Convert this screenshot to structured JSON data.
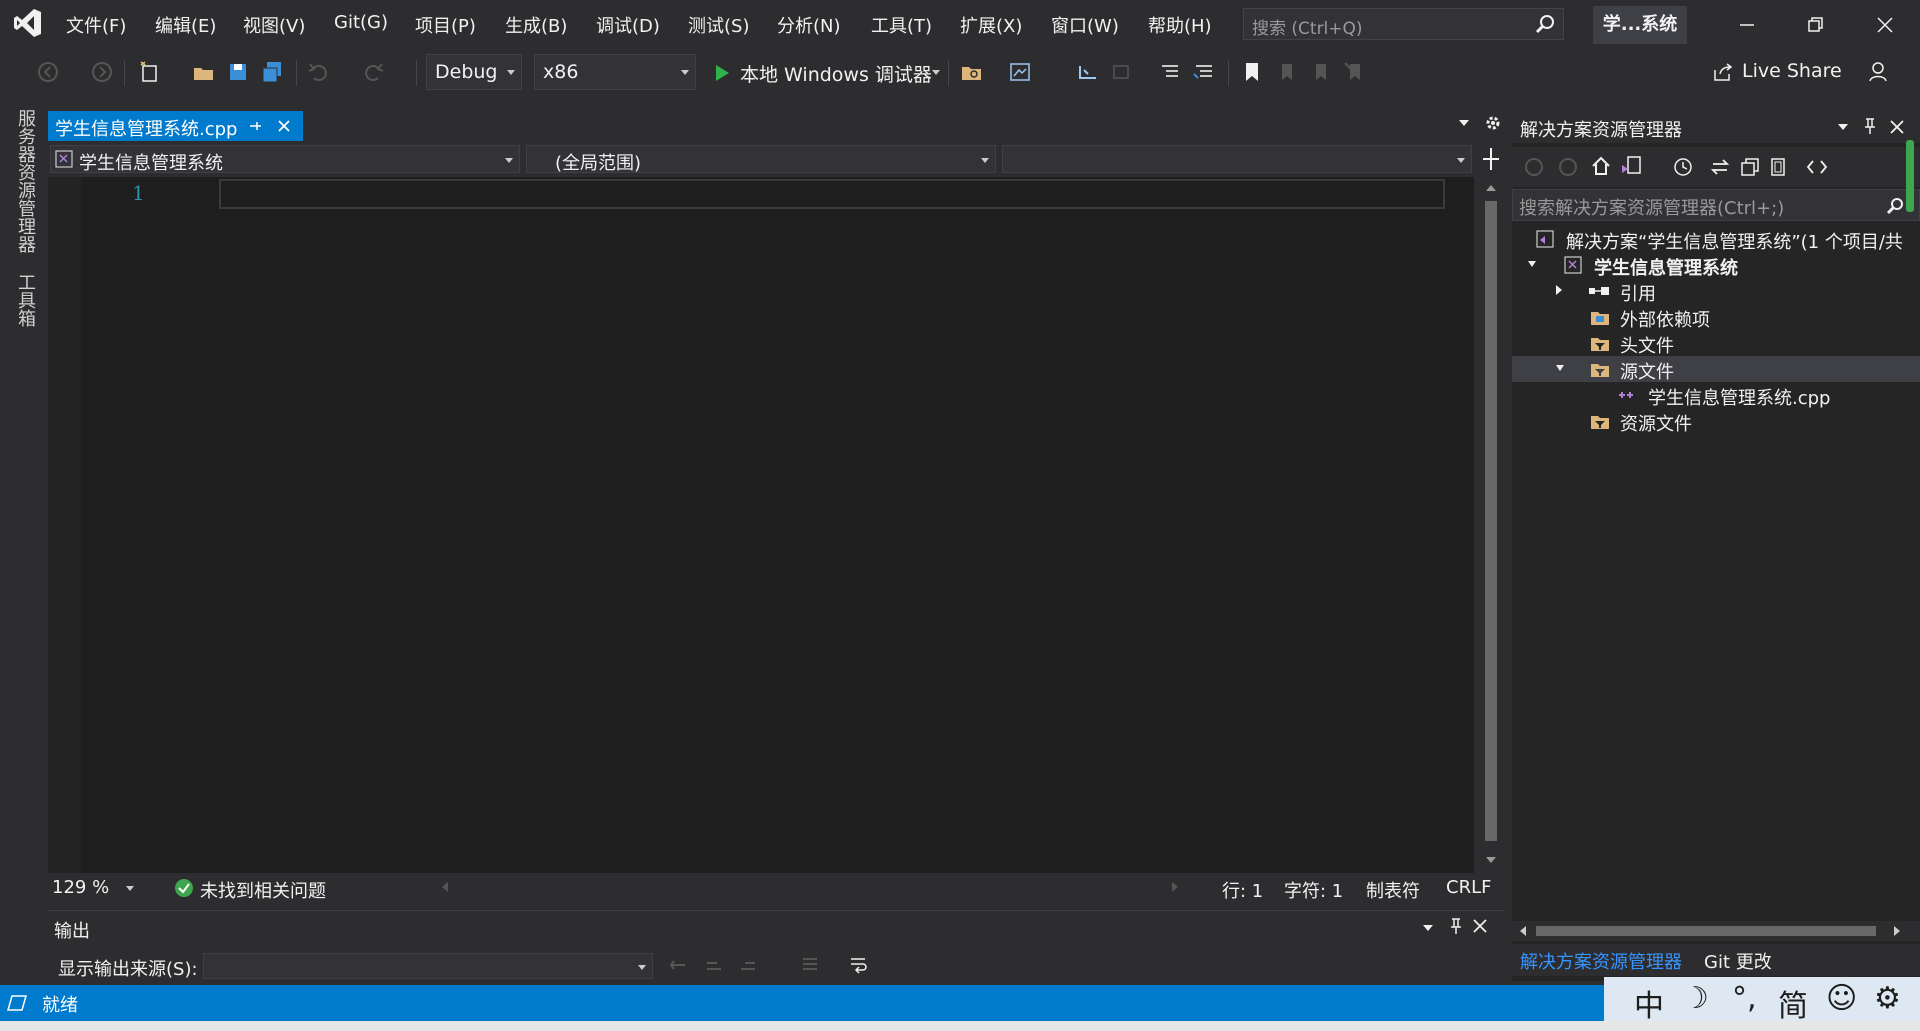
{
  "menu": [
    "文件(F)",
    "编辑(E)",
    "视图(V)",
    "Git(G)",
    "项目(P)",
    "生成(B)",
    "调试(D)",
    "测试(S)",
    "分析(N)",
    "工具(T)",
    "扩展(X)",
    "窗口(W)",
    "帮助(H)"
  ],
  "search": {
    "placeholder": "搜索 (Ctrl+Q)"
  },
  "title_badge": "学...系统",
  "toolbar": {
    "config": "Debug",
    "platform": "x86",
    "run_label": "本地 Windows 调试器",
    "live_share": "Live Share"
  },
  "left_tabs": [
    "服务器资源管理器",
    "工具箱"
  ],
  "editor": {
    "tab_title": "学生信息管理系统.cpp",
    "nav_project": "学生信息管理系统",
    "nav_scope": "(全局范围)",
    "nav_member": "",
    "line_number": "1"
  },
  "editor_status": {
    "zoom": "129 %",
    "issues": "未找到相关问题",
    "line": "行: 1",
    "char": "字符: 1",
    "tab_mode": "制表符",
    "eol": "CRLF"
  },
  "output": {
    "title": "输出",
    "source_label": "显示输出来源(S):",
    "source_value": ""
  },
  "solution_explorer": {
    "title": "解决方案资源管理器",
    "search_placeholder": "搜索解决方案资源管理器(Ctrl+;)",
    "tree": [
      {
        "label": "解决方案“学生信息管理系统”(1 个项目/共 ",
        "icon": "solution-icon"
      },
      {
        "label": "学生信息管理系统",
        "icon": "cpp-project-icon"
      },
      {
        "label": "引用",
        "icon": "references-icon"
      },
      {
        "label": "外部依赖项",
        "icon": "external-deps-icon"
      },
      {
        "label": "头文件",
        "icon": "filter-folder-icon"
      },
      {
        "label": "源文件",
        "icon": "filter-folder-icon"
      },
      {
        "label": "学生信息管理系统.cpp",
        "icon": "cpp-file-icon"
      },
      {
        "label": "资源文件",
        "icon": "filter-folder-icon"
      }
    ],
    "bottom_tabs": [
      "解决方案资源管理器",
      "Git 更改"
    ]
  },
  "statusbar": {
    "ready": "就绪"
  },
  "ime": {
    "mode": "中",
    "moon": "☽",
    "punct": "°,",
    "simplified": "简",
    "emoji": "☺",
    "settings": "⚙"
  },
  "colors": {
    "accent": "#007acc",
    "background": "#1e1e1e",
    "chrome": "#2d2d30",
    "vs_purple": "#68217a"
  }
}
